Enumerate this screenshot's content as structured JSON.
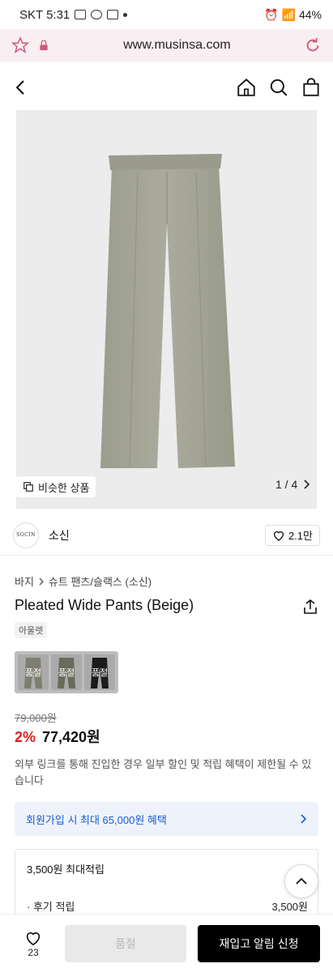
{
  "status": {
    "carrier": "SKT 5:31",
    "battery": "44%"
  },
  "browser": {
    "url": "www.musinsa.com"
  },
  "gallery": {
    "similar_label": "비슷한 상품",
    "counter": "1 / 4"
  },
  "brand": {
    "logo_text": "SOCIN",
    "name": "소신",
    "likes": "2.1만"
  },
  "breadcrumb": {
    "first": "바지",
    "second": "슈트 팬츠/슬랙스 (소신)"
  },
  "product": {
    "title": "Pleated Wide Pants (Beige)",
    "tag": "아울렛",
    "swatches": [
      {
        "label": "품절",
        "color": "#7e7d6f"
      },
      {
        "label": "품절",
        "color": "#6a6b5a"
      },
      {
        "label": "품절",
        "color": "#1b1b1b"
      }
    ],
    "original_price": "79,000원",
    "discount": "2%",
    "price": "77,420원",
    "notice": "외부 링크를 통해 진입한 경우 일부 할인 및 적립 혜택이 제한될 수 있습니다"
  },
  "member_banner": "회원가입 시 최대 65,000원 혜택",
  "points": {
    "title": "3,500원 최대적립",
    "row_label": "· 후기 적립",
    "row_value": "3,500원"
  },
  "bottom": {
    "like_count": "23",
    "soldout_label": "품절",
    "restock_label": "재입고 알림 신청"
  },
  "colors": {
    "accent_red": "#e02020",
    "link_blue": "#1c5bd6",
    "pants": "#a4a496"
  }
}
